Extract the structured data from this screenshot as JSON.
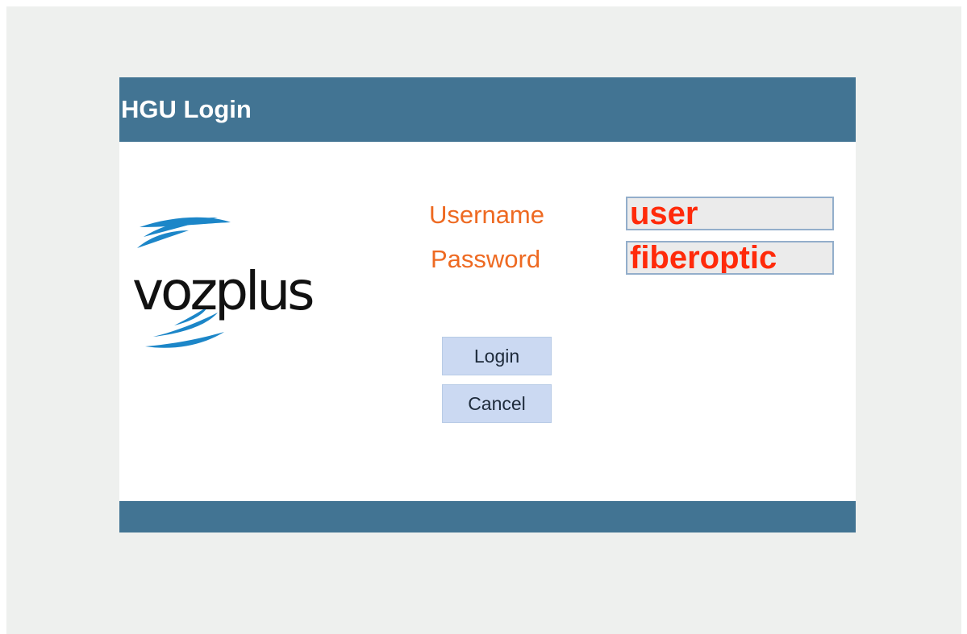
{
  "panel": {
    "title": "HGU Login"
  },
  "logo": {
    "text": "vozplus",
    "icon": "vozplus-logo",
    "brand_color": "#1c86c8"
  },
  "form": {
    "username_label": "Username",
    "password_label": "Password",
    "username_value": "user",
    "password_value": "fiberoptic"
  },
  "buttons": {
    "login_label": "Login",
    "cancel_label": "Cancel"
  },
  "colors": {
    "header": "#427493",
    "label": "#ee6a22",
    "input_text": "#ff2a0a",
    "button": "#cbd9f2",
    "page_background": "#eef0ee"
  }
}
